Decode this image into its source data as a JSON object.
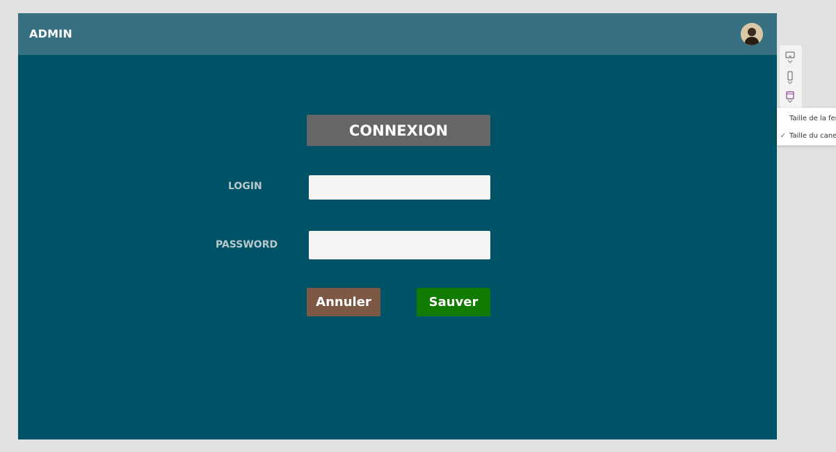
{
  "header": {
    "title": "ADMIN"
  },
  "form": {
    "heading": "CONNEXION",
    "login_label": "LOGIN",
    "login_value": "",
    "password_label": "PASSWORD",
    "password_value": "",
    "cancel_label": "Annuler",
    "save_label": "Sauver"
  },
  "colors": {
    "canvas_bg": "#005366",
    "header_bg": "#377080",
    "heading_bg": "#666666",
    "cancel_bg": "#7d5945",
    "save_bg": "#117a00"
  },
  "side_tools": {
    "icons": [
      "monitor-icon",
      "phone-icon",
      "tablet-icon"
    ],
    "menu_items": [
      {
        "label": "Taille de la fen",
        "checked": false
      },
      {
        "label": "Taille du canev",
        "checked": true
      }
    ]
  }
}
